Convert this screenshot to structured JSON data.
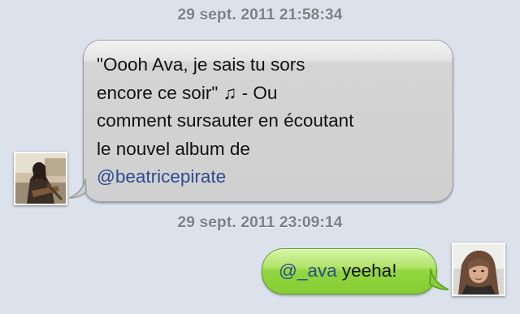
{
  "conversation": {
    "messages": [
      {
        "timestamp": "29 sept. 2011 21:58:34",
        "direction": "incoming",
        "lines": [
          "\"Oooh Ava, je sais tu sors",
          "encore ce soir\" ♫ - Ou",
          "comment sursauter en écoutant",
          "le nouvel album de"
        ],
        "mention": "@beatricepirate",
        "bubble_color": "#d0d0d0"
      },
      {
        "timestamp": "29 sept. 2011 23:09:14",
        "direction": "outgoing",
        "mention": "@_ava",
        "text": " yeeha!",
        "bubble_color": "#86cc35"
      }
    ]
  },
  "colors": {
    "background": "#dbe2ec",
    "timestamp_text": "#7a7f88",
    "mention_link": "#2c4b8f"
  }
}
